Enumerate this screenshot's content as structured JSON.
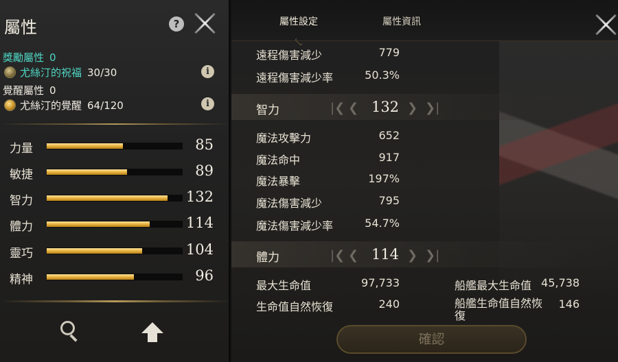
{
  "left": {
    "title": "屬性",
    "bonus_label": "獎勵屬性",
    "bonus_value": "0",
    "blessing_name": "尤絲汀的祝福",
    "blessing_value": "30/30",
    "awaken_label": "覺醒屬性",
    "awaken_value": "0",
    "awakening_name": "尤絲汀的覺醒",
    "awakening_value": "64/120",
    "stats": [
      {
        "name": "力量",
        "value": "85",
        "fill": 0.56
      },
      {
        "name": "敏捷",
        "value": "89",
        "fill": 0.59
      },
      {
        "name": "智力",
        "value": "132",
        "fill": 0.89
      },
      {
        "name": "體力",
        "value": "114",
        "fill": 0.76
      },
      {
        "name": "靈巧",
        "value": "104",
        "fill": 0.7
      },
      {
        "name": "精神",
        "value": "96",
        "fill": 0.64
      }
    ]
  },
  "right": {
    "tabs": {
      "active": "屬性設定",
      "inactive": "屬性資訊"
    },
    "rows_top": [
      {
        "label": "遠程傷害減少",
        "value": "779"
      },
      {
        "label": "遠程傷害減少率",
        "value": "50.3%"
      }
    ],
    "int_stepper": {
      "label": "智力",
      "value": "132"
    },
    "int_rows": [
      {
        "label": "魔法攻擊力",
        "value": "652"
      },
      {
        "label": "魔法命中",
        "value": "917"
      },
      {
        "label": "魔法暴擊",
        "value": "197%"
      },
      {
        "label": "魔法傷害減少",
        "value": "795"
      },
      {
        "label": "魔法傷害減少率",
        "value": "54.7%"
      }
    ],
    "vit_stepper": {
      "label": "體力",
      "value": "114"
    },
    "vit_rows_left": [
      {
        "label": "最大生命值",
        "value": "97,733"
      },
      {
        "label": "生命值自然恢復",
        "value": "240"
      }
    ],
    "vit_rows_right": [
      {
        "label": "船艦最大生命值",
        "value": "45,738"
      },
      {
        "label": "船艦生命值自然恢\n復",
        "value": "146"
      }
    ],
    "confirm_label": "確認"
  },
  "icons": {
    "help": "?",
    "info": "i"
  }
}
